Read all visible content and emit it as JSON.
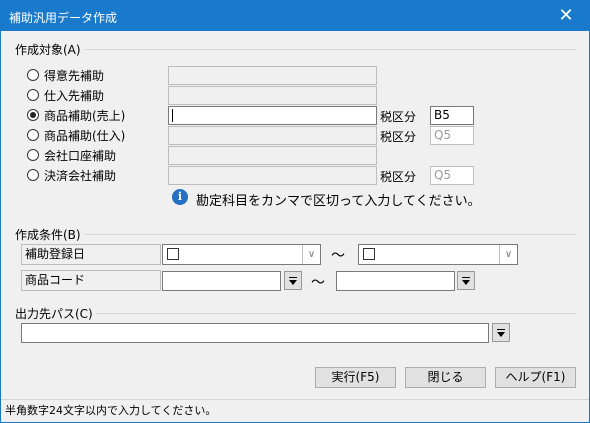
{
  "window": {
    "title": "補助汎用データ作成",
    "close": "✕"
  },
  "target_group": {
    "label": "作成対象(A)",
    "options": [
      {
        "label": "得意先補助",
        "selected": false
      },
      {
        "label": "仕入先補助",
        "selected": false
      },
      {
        "label": "商品補助(売上)",
        "selected": true
      },
      {
        "label": "商品補助(仕入)",
        "selected": false
      },
      {
        "label": "会社口座補助",
        "selected": false
      },
      {
        "label": "決済会社補助",
        "selected": false
      }
    ],
    "tax_label": "税区分",
    "tax_values": [
      "B5",
      "Q5",
      "Q5"
    ],
    "info_text": "勘定科目をカンマで区切って入力してください。"
  },
  "condition_group": {
    "label": "作成条件(B)",
    "date_label": "補助登録日",
    "product_code_label": "商品コード",
    "tilde": "～"
  },
  "output_group": {
    "label": "出力先パス(C)"
  },
  "buttons": {
    "run": "実行(F5)",
    "close": "閉じる",
    "help": "ヘルプ(F1)"
  },
  "status": "半角数字24文字以内で入力してください。"
}
